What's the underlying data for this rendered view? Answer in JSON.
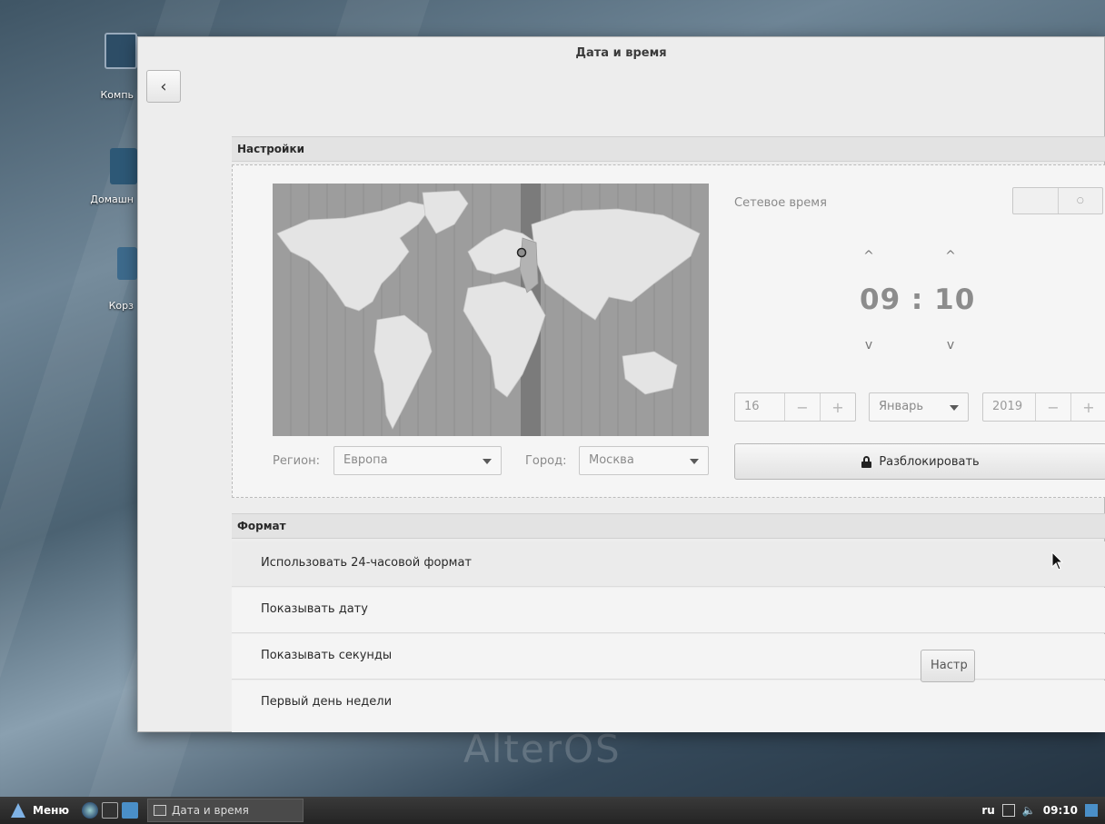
{
  "window": {
    "title": "Дата и время"
  },
  "desktop": {
    "icons": [
      {
        "label": "Компь"
      },
      {
        "label": "Домашн"
      },
      {
        "label": "Корз"
      }
    ],
    "watermark": "AlterOS"
  },
  "settings": {
    "header": "Настройки",
    "region_label": "Регион:",
    "region_value": "Европа",
    "city_label": "Город:",
    "city_value": "Москва",
    "network_time_label": "Сетевое время",
    "time_display": "09 : 10",
    "day_value": "16",
    "month_value": "Январь",
    "year_value": "2019",
    "minus_symbol": "−",
    "plus_symbol": "+",
    "up_symbol": "^",
    "down_symbol": "v",
    "unlock_label": "Разблокировать"
  },
  "format": {
    "header": "Формат",
    "rows": [
      {
        "label": "Использовать 24-часовой формат"
      },
      {
        "label": "Показывать дату"
      },
      {
        "label": "Показывать секунды"
      },
      {
        "label": "Первый день недели"
      }
    ],
    "first_day_button": "Настр"
  },
  "taskbar": {
    "menu_label": "Меню",
    "task_label": "Дата и время",
    "lang": "ru",
    "clock": "09:10"
  }
}
